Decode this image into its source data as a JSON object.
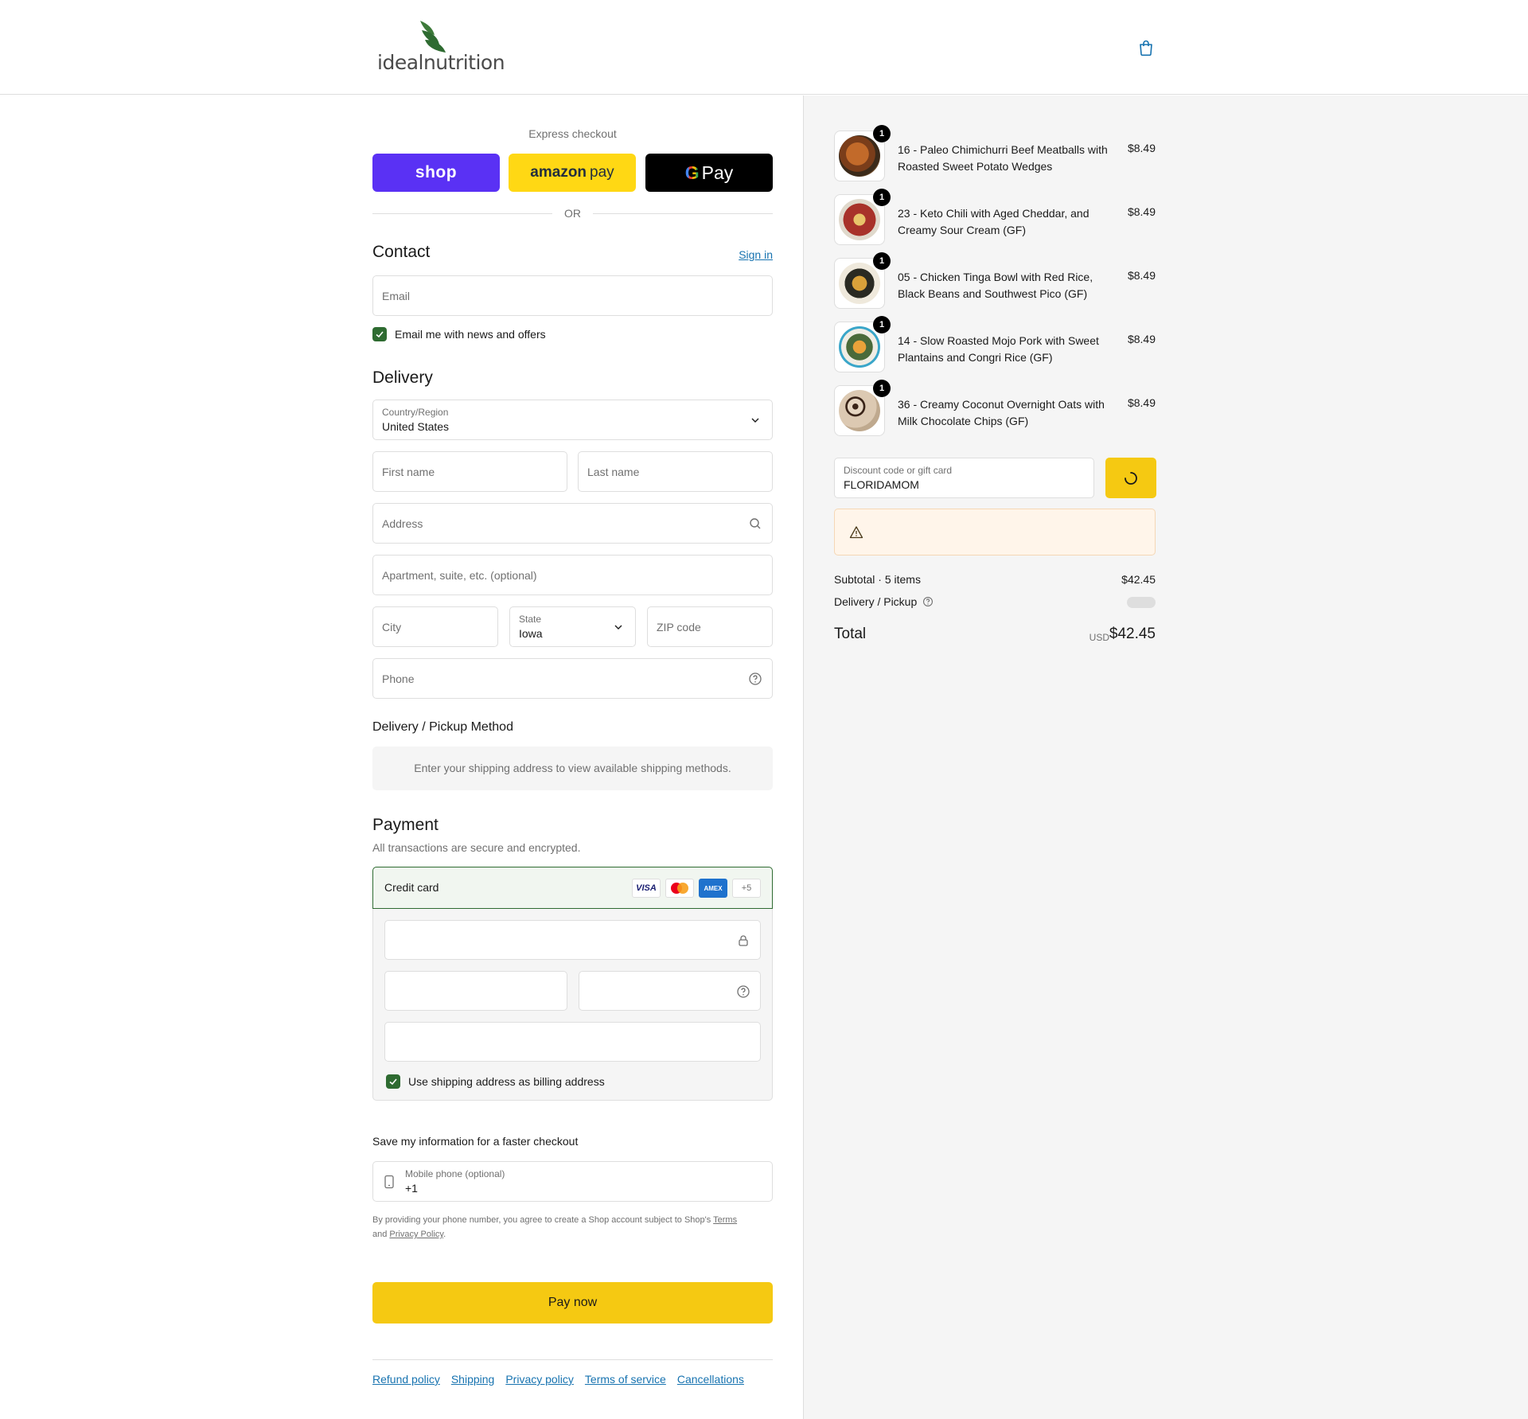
{
  "brand": {
    "logo_text": "idealnutrition",
    "accent": "#f5c912",
    "link": "#1773b0",
    "success": "#2e6b31"
  },
  "header": {
    "cart_icon": "shopping-bag-icon"
  },
  "express": {
    "title": "Express checkout",
    "shop_label": "shop",
    "amazon_label": "amazon",
    "amazon_pay": "pay",
    "gpay_g": "G",
    "gpay_label": "Pay",
    "or_label": "OR"
  },
  "contact": {
    "heading": "Contact",
    "sign_in": "Sign in",
    "email_placeholder": "Email",
    "news_label": "Email me with news and offers"
  },
  "delivery": {
    "heading": "Delivery",
    "country_label": "Country/Region",
    "country_value": "United States",
    "first_name": "First name",
    "last_name": "Last name",
    "address": "Address",
    "apartment": "Apartment, suite, etc. (optional)",
    "city": "City",
    "state_label": "State",
    "state_value": "Iowa",
    "zip": "ZIP code",
    "phone": "Phone",
    "method_heading": "Delivery / Pickup Method",
    "method_info": "Enter your shipping address to view available shipping methods."
  },
  "payment": {
    "heading": "Payment",
    "subtitle": "All transactions are secure and encrypted.",
    "credit_card": "Credit card",
    "cards": [
      "VISA",
      "AMEX",
      "+5"
    ],
    "billing_label": "Use shipping address as billing address"
  },
  "save_info": {
    "heading": "Save my information for a faster checkout",
    "mobile_label": "Mobile phone (optional)",
    "mobile_value": "+1",
    "disclaimer_pre": "By providing your phone number, you agree to create a Shop account subject to Shop's ",
    "terms": "Terms",
    "and": " and ",
    "privacy": "Privacy Policy",
    "dot": "."
  },
  "pay_now": "Pay now",
  "footer": [
    "Refund policy",
    "Shipping",
    "Privacy policy",
    "Terms of service",
    "Cancellations"
  ],
  "items": [
    {
      "qty": "1",
      "name": "16 - Paleo Chimichurri Beef Meatballs with Roasted Sweet Potato Wedges",
      "price": "$8.49"
    },
    {
      "qty": "1",
      "name": "23 - Keto Chili with Aged Cheddar, and Creamy Sour Cream (GF)",
      "price": "$8.49"
    },
    {
      "qty": "1",
      "name": "05 - Chicken Tinga Bowl with Red Rice, Black Beans and Southwest Pico (GF)",
      "price": "$8.49"
    },
    {
      "qty": "1",
      "name": "14 - Slow Roasted Mojo Pork with Sweet Plantains and Congri Rice (GF)",
      "price": "$8.49"
    },
    {
      "qty": "1",
      "name": "36 - Creamy Coconut Overnight Oats with Milk Chocolate Chips (GF)",
      "price": "$8.49"
    }
  ],
  "discount": {
    "label": "Discount code or gift card",
    "value": "FLORIDAMOM"
  },
  "summary": {
    "subtotal_label": "Subtotal · 5 items",
    "subtotal_value": "$42.45",
    "delivery_label": "Delivery / Pickup",
    "total_label": "Total",
    "currency": "USD",
    "total_value": "$42.45"
  }
}
